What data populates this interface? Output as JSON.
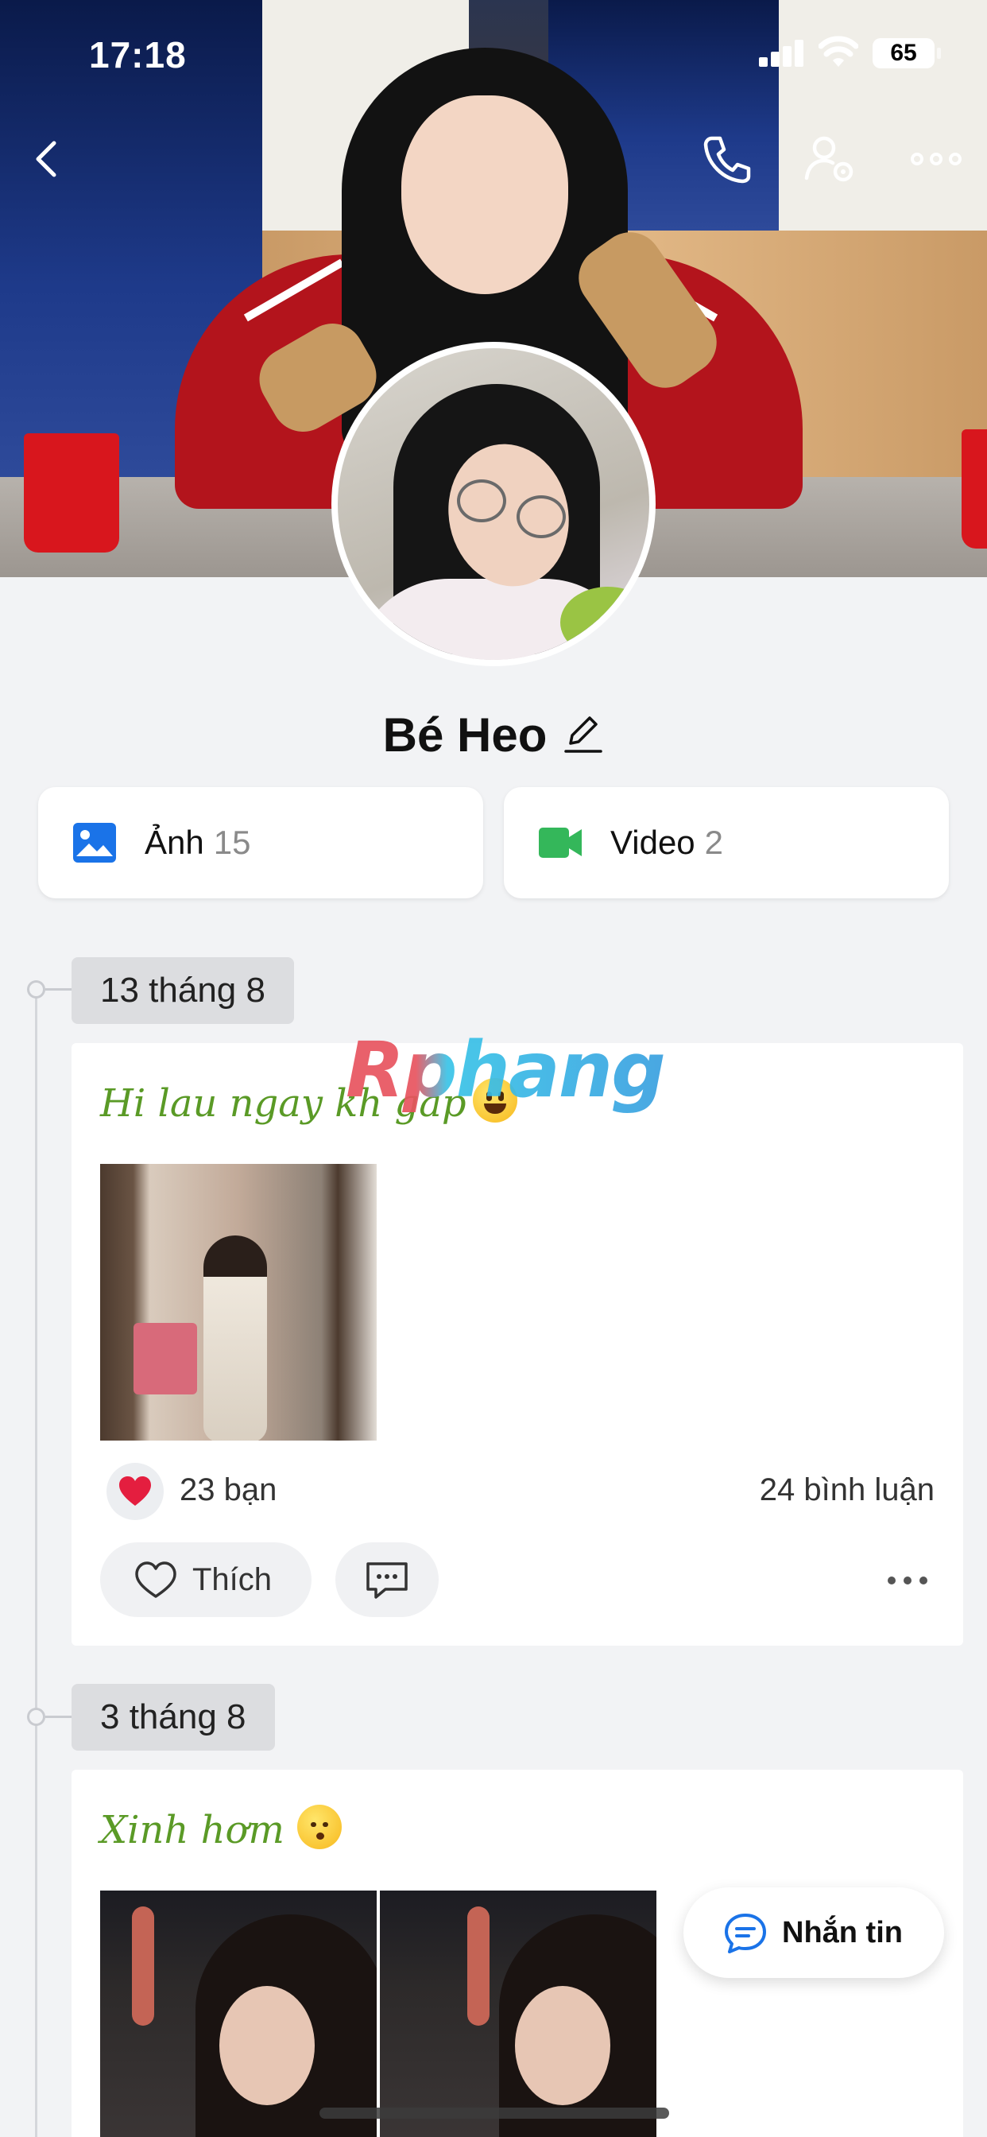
{
  "status_bar": {
    "time": "17:18",
    "battery": "65"
  },
  "profile": {
    "name": "Bé Heo"
  },
  "media": {
    "photos": {
      "label": "Ảnh",
      "count": "15"
    },
    "videos": {
      "label": "Video",
      "count": "2"
    }
  },
  "watermark": "Rphang",
  "posts": [
    {
      "date": "13 tháng 8",
      "caption": "Hi lau ngay kh gap",
      "reactions_count": "23 bạn",
      "comments_count": "24 bình luận",
      "like_label": "Thích"
    },
    {
      "date": "3 tháng 8",
      "caption": "Xinh hơm"
    }
  ],
  "fab": {
    "label": "Nhắn tin"
  },
  "icons": [
    "back-icon",
    "phone-icon",
    "user-settings-icon",
    "more-icon",
    "edit-icon",
    "image-icon",
    "video-icon",
    "heart-icon",
    "comment-icon",
    "chat-icon"
  ],
  "colors": {
    "accent_blue": "#1a73e8",
    "video_green": "#34b75a",
    "caption_green": "#5a9a26",
    "heart_red": "#e41e3f"
  }
}
